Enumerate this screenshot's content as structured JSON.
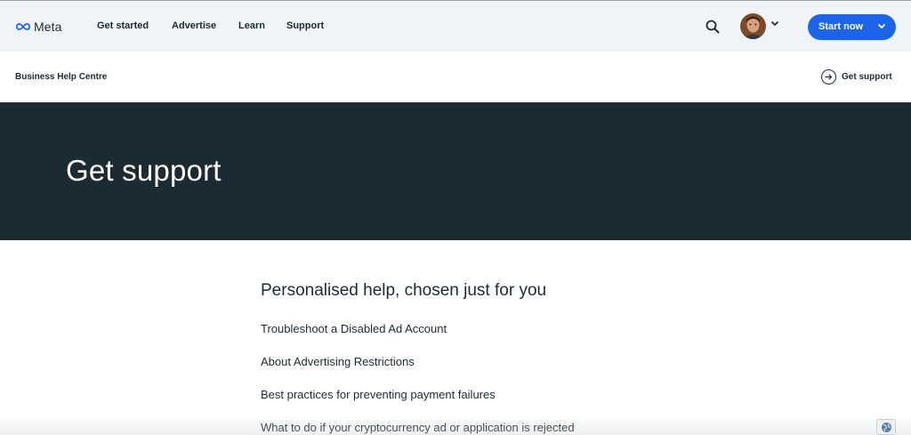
{
  "header": {
    "logo_text": "Meta",
    "nav": [
      {
        "label": "Get started"
      },
      {
        "label": "Advertise"
      },
      {
        "label": "Learn"
      },
      {
        "label": "Support"
      }
    ],
    "start_button_label": "Start now",
    "accent_color": "#1d65e8"
  },
  "subbar": {
    "breadcrumb": "Business Help Centre",
    "support_link": "Get support"
  },
  "hero": {
    "title": "Get support",
    "background_color": "#1c2b33"
  },
  "main": {
    "heading": "Personalised help, chosen just for you",
    "links": [
      {
        "label": "Troubleshoot a Disabled Ad Account"
      },
      {
        "label": "About Advertising Restrictions"
      },
      {
        "label": "Best practices for preventing payment failures"
      },
      {
        "label": "What to do if your cryptocurrency ad or application is rejected"
      }
    ]
  },
  "icons": {
    "logo": "meta-infinity-icon",
    "search": "search-icon",
    "avatar_chevron": "chevron-down-icon",
    "start_chevron": "chevron-down-icon",
    "support": "arrow-right-circle-icon",
    "language": "globe-icon"
  }
}
